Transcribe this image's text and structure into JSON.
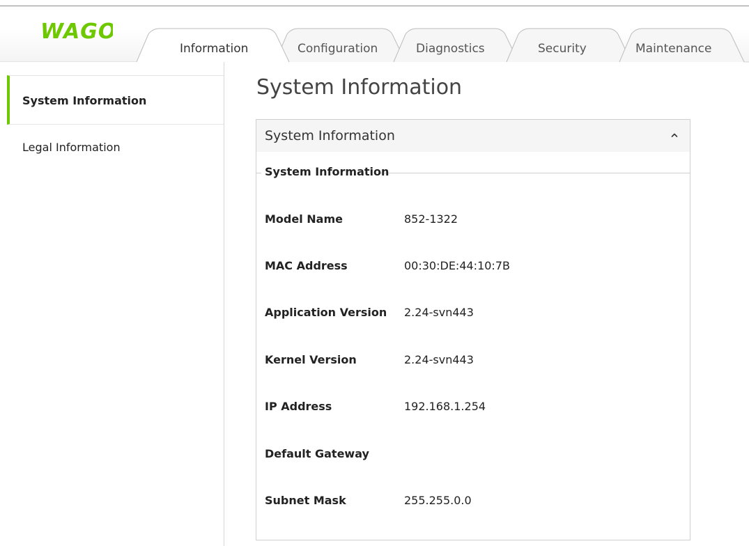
{
  "brand": {
    "logo_text": "WAGO",
    "accent_color": "#6ec800"
  },
  "tabs": [
    {
      "label": "Information",
      "active": true
    },
    {
      "label": "Configuration",
      "active": false
    },
    {
      "label": "Diagnostics",
      "active": false
    },
    {
      "label": "Security",
      "active": false
    },
    {
      "label": "Maintenance",
      "active": false
    }
  ],
  "sidebar": {
    "items": [
      {
        "label": "System Information",
        "active": true
      },
      {
        "label": "Legal Information",
        "active": false
      }
    ]
  },
  "main": {
    "page_title": "System Information",
    "panel": {
      "title": "System Information",
      "collapse_icon": "chevron-up-icon",
      "fieldset_legend": "System Information",
      "rows": [
        {
          "label": "Model Name",
          "value": "852-1322"
        },
        {
          "label": "MAC Address",
          "value": "00:30:DE:44:10:7B"
        },
        {
          "label": "Application Version",
          "value": "2.24-svn443"
        },
        {
          "label": "Kernel Version",
          "value": "2.24-svn443"
        },
        {
          "label": "IP Address",
          "value": "192.168.1.254"
        },
        {
          "label": "Default Gateway",
          "value": ""
        },
        {
          "label": "Subnet Mask",
          "value": "255.255.0.0"
        }
      ]
    }
  }
}
